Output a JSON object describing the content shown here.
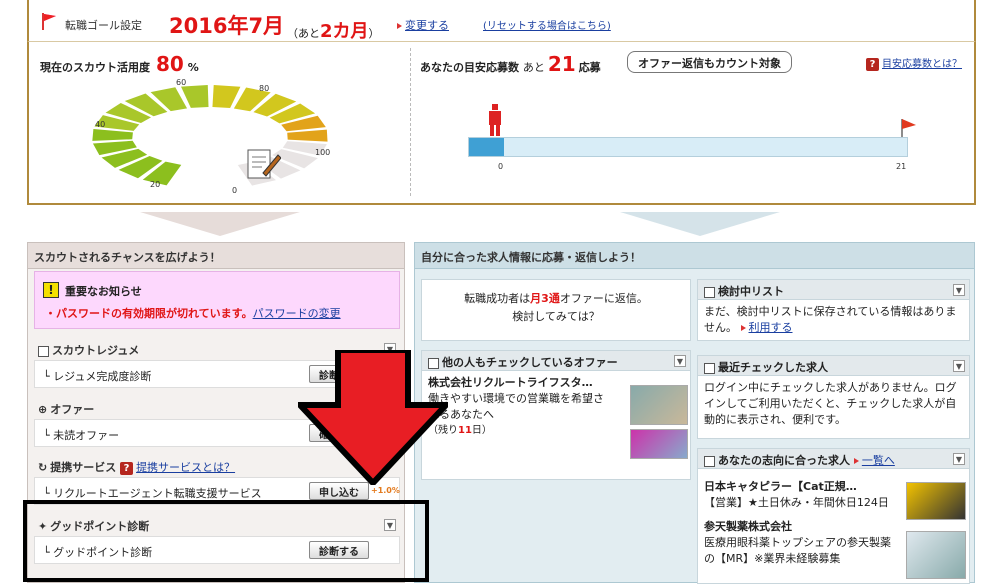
{
  "goal": {
    "label": "転職ゴール設定",
    "date": "2016年7月",
    "ato_prefix": "（あと",
    "ato_value": "2カ月",
    "ato_suffix": "）",
    "change_link": "変更する",
    "reset_link": "(リセットする場合はこちら)"
  },
  "scout": {
    "label": "現在のスカウト活用度",
    "value": "80",
    "unit": "%",
    "gauge_ticks": [
      "60",
      "80",
      "40",
      "100",
      "20",
      "0"
    ],
    "gauge_value": 80
  },
  "apply": {
    "label": "あなたの目安応募数",
    "ato": "あと",
    "value": "21",
    "unit": "応募",
    "bubble": "オファー返信もカウント対象",
    "help_link": "目安応募数とは？",
    "bar_min": "0",
    "bar_max": "21",
    "progress_fraction": 0.08
  },
  "left_panel": {
    "title": "スカウトされるチャンスを広げよう！",
    "notice_title": "重要なお知らせ",
    "notice_msg": "・パスワードの有効期限が切れています。",
    "notice_link": "パスワードの変更",
    "sections": [
      {
        "title": "スカウトレジュメ",
        "item": "└ レジュメ完成度診断",
        "button": "診断する"
      },
      {
        "title": "オファー",
        "item": "└ 未読オファー",
        "button": "確認する"
      },
      {
        "title": "提携サービス",
        "help": "提携サービスとは？",
        "item": "└ リクルートエージェント転職支援サービス",
        "button": "申し込む",
        "badge": "+1.0%"
      },
      {
        "title": "グッドポイント診断",
        "item": "└ グッドポイント診断",
        "button": "診断する"
      }
    ]
  },
  "right_panel": {
    "title": "自分に合った求人情報に応募・返信しよう！",
    "success": {
      "line1_a": "転職成功者は",
      "line1_b": "月3通",
      "line1_c": "オファーに返信。",
      "line2": "検討してみては？"
    },
    "others": {
      "title": "他の人もチェックしているオファー",
      "company": "株式会社リクルートライフスタ…",
      "desc": "働きやすい環境での営業職を希望さ",
      "desc2": "れるあなたへ",
      "remain_a": "（残り",
      "remain_b": "11",
      "remain_c": "日）"
    },
    "checklist": {
      "title": "検討中リスト",
      "text": "まだ、検討中リストに保存されている情報はありません。",
      "link": "利用する"
    },
    "recent": {
      "title": "最近チェックした求人",
      "text": "ログイン中にチェックした求人がありません。ログインしてご利用いただくと、チェックした求人が自動的に表示され、便利です。"
    },
    "match": {
      "title": "あなたの志向に合った求人",
      "link": "一覧へ",
      "jobs": [
        {
          "company": "日本キャタピラー【Cat正規…",
          "desc": "【営業】★土日休み・年間休日124日"
        },
        {
          "company": "参天製薬株式会社",
          "desc": "医療用眼科薬トップシェアの参天製薬の【MR】※業界未経験募集"
        }
      ]
    }
  },
  "colors": {
    "accent_red": "#e01515",
    "link_blue": "#1a3fa0",
    "bar_blue": "#3fa0d4"
  }
}
